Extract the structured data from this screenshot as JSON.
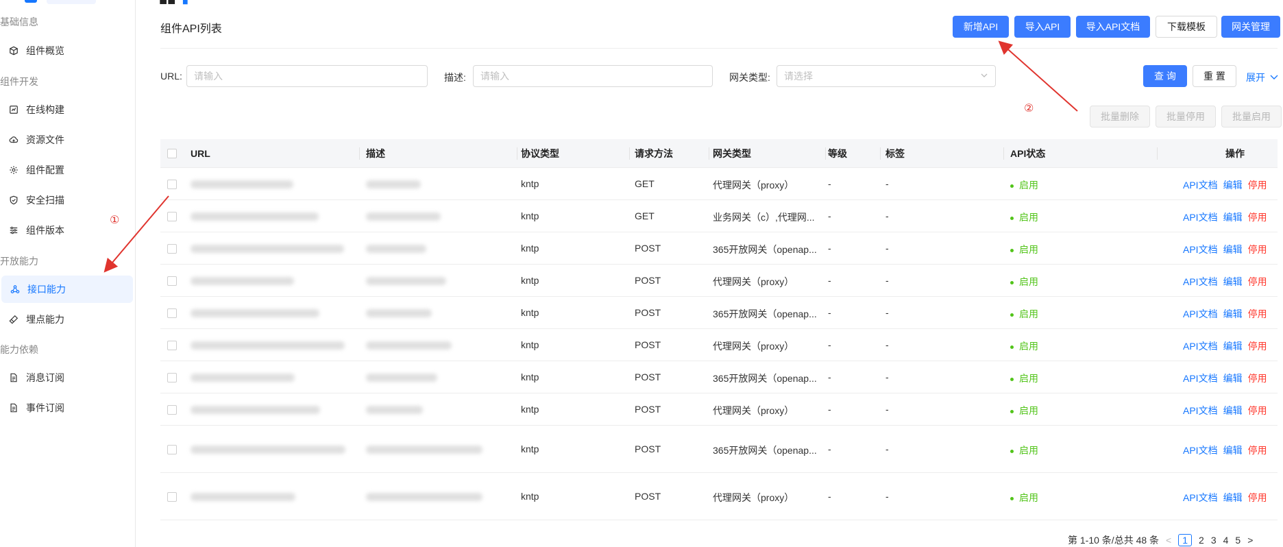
{
  "sidebar": {
    "groups": [
      {
        "title": "基础信息",
        "items": [
          {
            "label": "组件概览",
            "icon": "cube-icon"
          }
        ]
      },
      {
        "title": "组件开发",
        "items": [
          {
            "label": "在线构建",
            "icon": "build-icon"
          },
          {
            "label": "资源文件",
            "icon": "cloud-icon"
          },
          {
            "label": "组件配置",
            "icon": "gear-icon"
          },
          {
            "label": "安全扫描",
            "icon": "shield-icon"
          },
          {
            "label": "组件版本",
            "icon": "sliders-icon"
          }
        ]
      },
      {
        "title": "开放能力",
        "items": [
          {
            "label": "接口能力",
            "icon": "nodes-icon",
            "active": true
          },
          {
            "label": "埋点能力",
            "icon": "probe-icon"
          }
        ]
      },
      {
        "title": "能力依赖",
        "items": [
          {
            "label": "消息订阅",
            "icon": "doc-icon"
          },
          {
            "label": "事件订阅",
            "icon": "doc-icon"
          }
        ]
      }
    ]
  },
  "header": {
    "section_title": "组件API列表",
    "buttons": {
      "add_api": "新增API",
      "import_api": "导入API",
      "import_api_doc": "导入API文档",
      "download_template": "下载模板",
      "gateway_manage": "网关管理"
    }
  },
  "filters": {
    "url_label": "URL:",
    "url_placeholder": "请输入",
    "desc_label": "描述:",
    "desc_placeholder": "请输入",
    "gateway_label": "网关类型:",
    "gateway_placeholder": "请选择",
    "query": "查 询",
    "reset": "重 置",
    "expand": "展开"
  },
  "batch": {
    "delete": "批量删除",
    "disable": "批量停用",
    "enable": "批量启用"
  },
  "table": {
    "columns": [
      "URL",
      "描述",
      "协议类型",
      "请求方法",
      "网关类型",
      "等级",
      "标签",
      "API状态",
      "操作"
    ],
    "rows": [
      {
        "protocol": "kntp",
        "method": "GET",
        "gateway": "代理网关（proxy）",
        "level": "-",
        "tag": "-",
        "status": "启用"
      },
      {
        "protocol": "kntp",
        "method": "GET",
        "gateway": "业务网关（c）,代理网...",
        "level": "-",
        "tag": "-",
        "status": "启用"
      },
      {
        "protocol": "kntp",
        "method": "POST",
        "gateway": "365开放网关（openap...",
        "level": "-",
        "tag": "-",
        "status": "启用"
      },
      {
        "protocol": "kntp",
        "method": "POST",
        "gateway": "代理网关（proxy）",
        "level": "-",
        "tag": "-",
        "status": "启用"
      },
      {
        "protocol": "kntp",
        "method": "POST",
        "gateway": "365开放网关（openap...",
        "level": "-",
        "tag": "-",
        "status": "启用"
      },
      {
        "protocol": "kntp",
        "method": "POST",
        "gateway": "代理网关（proxy）",
        "level": "-",
        "tag": "-",
        "status": "启用"
      },
      {
        "protocol": "kntp",
        "method": "POST",
        "gateway": "365开放网关（openap...",
        "level": "-",
        "tag": "-",
        "status": "启用"
      },
      {
        "protocol": "kntp",
        "method": "POST",
        "gateway": "代理网关（proxy）",
        "level": "-",
        "tag": "-",
        "status": "启用"
      },
      {
        "protocol": "kntp",
        "method": "POST",
        "gateway": "365开放网关（openap...",
        "level": "-",
        "tag": "-",
        "status": "启用"
      },
      {
        "protocol": "kntp",
        "method": "POST",
        "gateway": "代理网关（proxy）",
        "level": "-",
        "tag": "-",
        "status": "启用"
      }
    ],
    "ops": {
      "doc": "API文档",
      "edit": "编辑",
      "disable": "停用"
    }
  },
  "pagination": {
    "summary": "第 1-10 条/总共 48 条",
    "pages": [
      "1",
      "2",
      "3",
      "4",
      "5"
    ],
    "current": "1"
  },
  "annotations": {
    "one": "①",
    "two": "②"
  },
  "colors": {
    "primary": "#3b7cff",
    "success": "#52c41a",
    "danger": "#ff3b30",
    "annotation": "#e0342e"
  }
}
